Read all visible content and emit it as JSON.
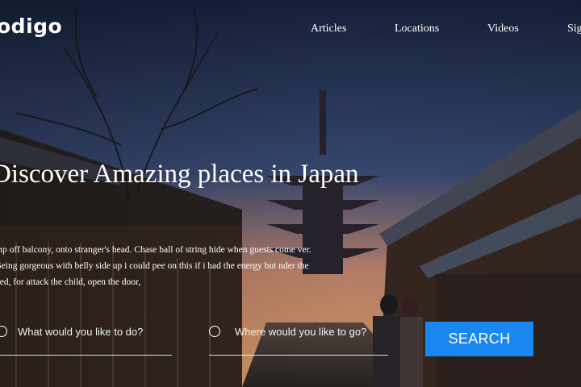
{
  "header": {
    "logo": "odigo",
    "nav": [
      {
        "label": "Articles"
      },
      {
        "label": "Locations"
      },
      {
        "label": "Videos"
      },
      {
        "label": "Sig"
      }
    ]
  },
  "hero": {
    "title": "Discover Amazing places in Japan",
    "text": "mp off balcony, onto stranger's head. Chase ball of string hide when guests come ver. Being gorgeous with belly side up i could pee on this if i had the energy but nder the bed, for attack the child, open the door,"
  },
  "search": {
    "activity_placeholder": "What would you like to do?",
    "location_placeholder": "Where would you like to go?",
    "button_label": "SEARCH"
  },
  "colors": {
    "accent": "#1a86f0",
    "sky_top": "#1b2a4a",
    "sky_glow": "#d9916a"
  },
  "icons": [
    "radio-circle-icon"
  ]
}
